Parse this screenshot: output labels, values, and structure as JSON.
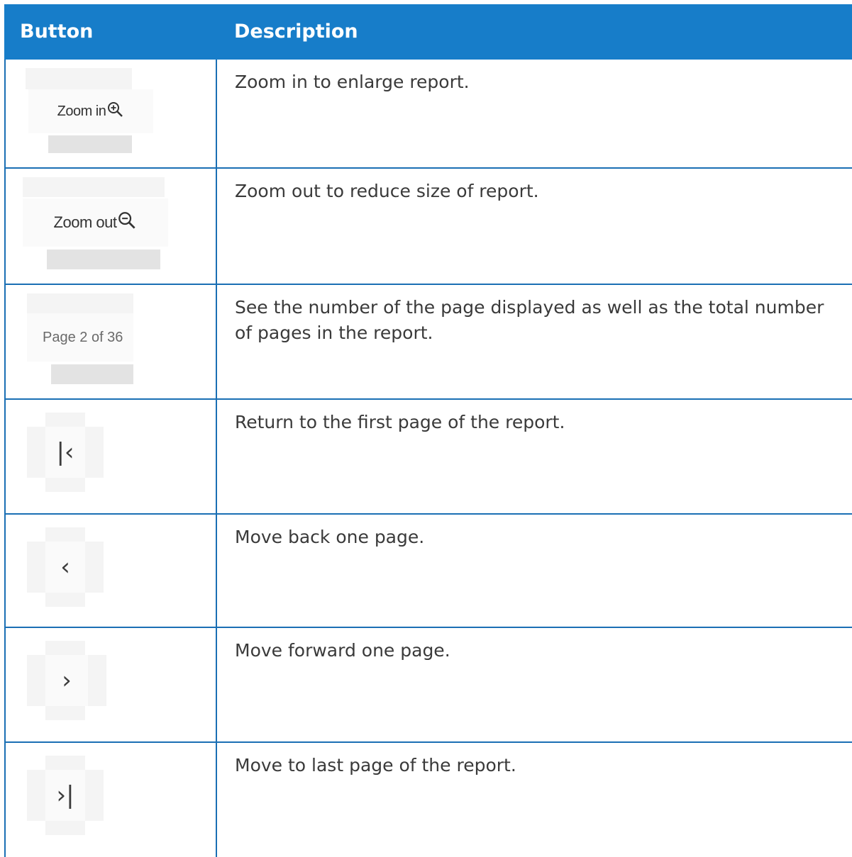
{
  "table": {
    "headers": {
      "button": "Button",
      "description": "Description"
    },
    "rows": [
      {
        "button_label": "Zoom in",
        "icon": "zoom-in-icon",
        "description": "Zoom in to enlarge report."
      },
      {
        "button_label": "Zoom out",
        "icon": "zoom-out-icon",
        "description": "Zoom out to reduce size of report."
      },
      {
        "button_label": "Page 2 of 36",
        "description": "See the number of the page displayed as well as the total number of pages in the report."
      },
      {
        "icon": "first-page-icon",
        "description": "Return to the first page of the report."
      },
      {
        "icon": "previous-page-icon",
        "description": "Move back one page."
      },
      {
        "icon": "next-page-icon",
        "description": "Move forward one page."
      },
      {
        "icon": "last-page-icon",
        "description": "Move to last page of the report."
      }
    ]
  },
  "colors": {
    "header_background": "#177dc9",
    "header_text": "#ffffff",
    "border": "#1a6fb4",
    "description_text": "#3a3a3a"
  }
}
